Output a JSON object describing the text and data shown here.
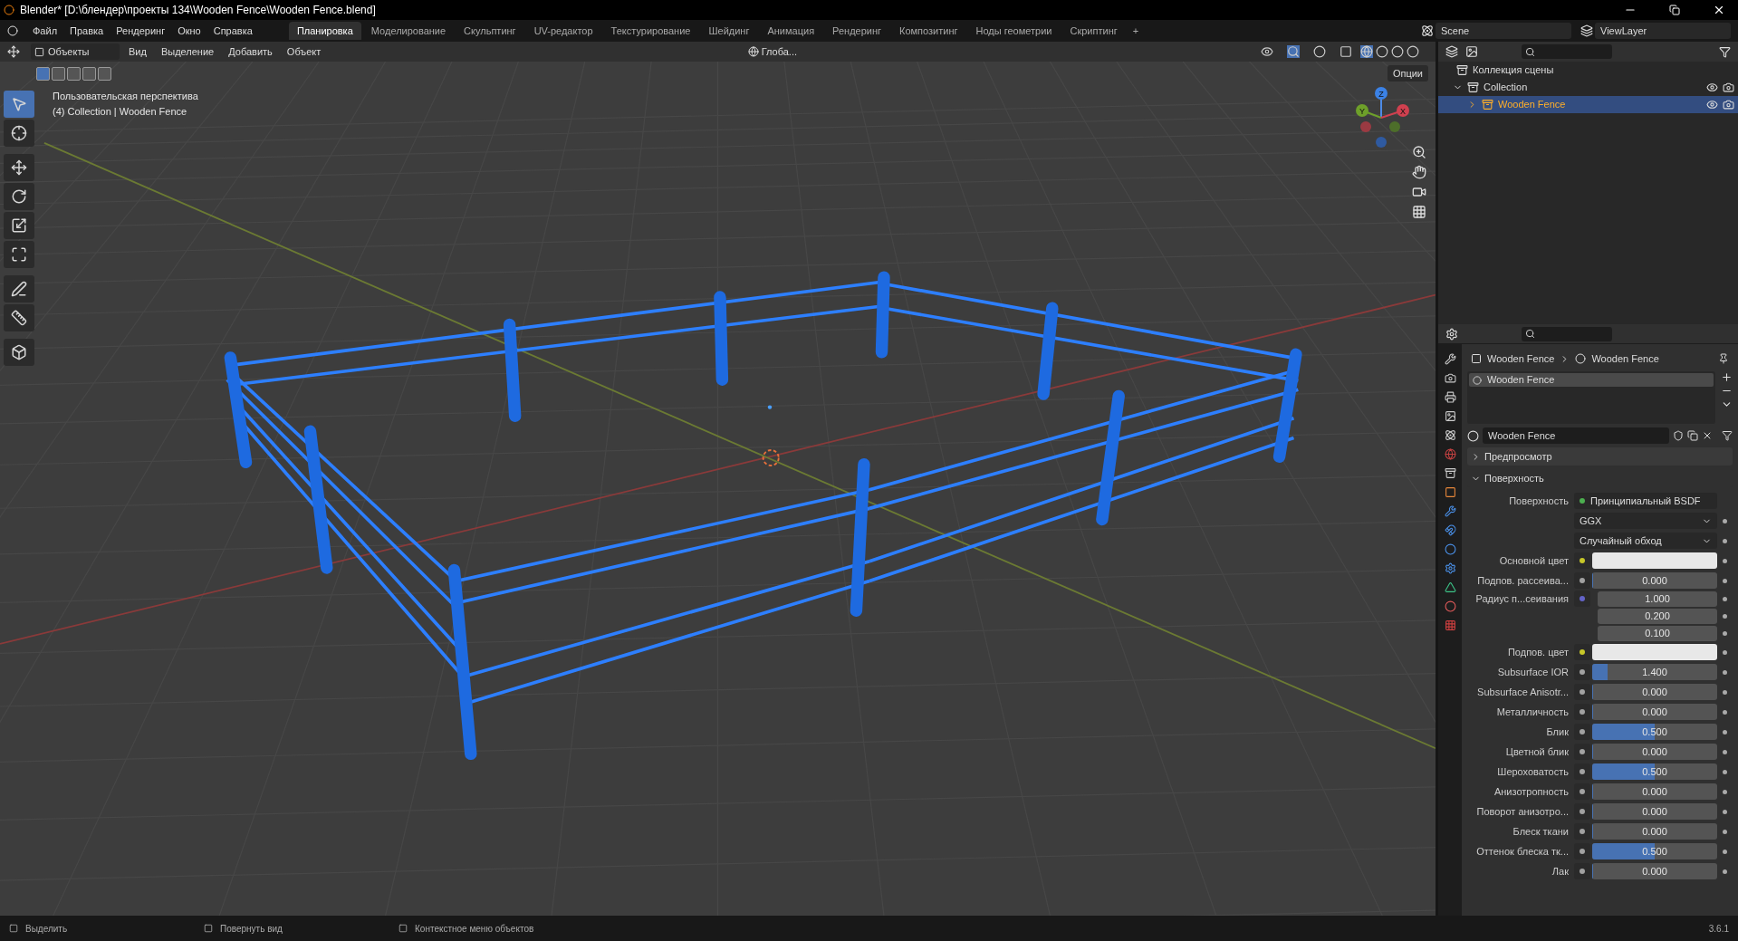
{
  "window": {
    "title": "Blender* [D:\\блендер\\проекты 134\\Wooden Fence\\Wooden Fence.blend]"
  },
  "menu": [
    "Файл",
    "Правка",
    "Рендеринг",
    "Окно",
    "Справка"
  ],
  "workspaces": [
    {
      "label": "Планировка",
      "selected": true
    },
    {
      "label": "Моделирование",
      "selected": false
    },
    {
      "label": "Скульптинг",
      "selected": false
    },
    {
      "label": "UV-редактор",
      "selected": false
    },
    {
      "label": "Текстурирование",
      "selected": false
    },
    {
      "label": "Шейдинг",
      "selected": false
    },
    {
      "label": "Анимация",
      "selected": false
    },
    {
      "label": "Рендеринг",
      "selected": false
    },
    {
      "label": "Композитинг",
      "selected": false
    },
    {
      "label": "Ноды геометрии",
      "selected": false
    },
    {
      "label": "Скриптинг",
      "selected": false
    }
  ],
  "add_workspace": "+",
  "scene": "Scene",
  "view_layer": "ViewLayer",
  "viewport_header": {
    "mode": "Объекты",
    "menus": [
      "Вид",
      "Выделение",
      "Добавить",
      "Объект"
    ],
    "orientation": "Глоба...",
    "options": "Опции"
  },
  "viewport": {
    "view_name": "Пользовательская перспектива",
    "context": "(4) Collection | Wooden Fence",
    "gizmo": {
      "z": "Z",
      "y": "Y",
      "x": "X"
    }
  },
  "tools": [
    {
      "kind": "select",
      "selected": true
    },
    {
      "kind": "cursor",
      "selected": false
    },
    {
      "kind": "move",
      "selected": false
    },
    {
      "kind": "rotate",
      "selected": false
    },
    {
      "kind": "scale",
      "selected": false
    },
    {
      "kind": "transform",
      "selected": false
    },
    {
      "kind": "annotate",
      "selected": false
    },
    {
      "kind": "measure",
      "selected": false
    },
    {
      "kind": "add",
      "selected": false
    }
  ],
  "outliner": {
    "root": "Коллекция сцены",
    "items": [
      {
        "label": "Collection",
        "expanded": true,
        "selected": false,
        "children": [
          {
            "label": "Wooden Fence",
            "expanded": false,
            "selected": true
          }
        ]
      }
    ]
  },
  "properties": {
    "breadcrumb": [
      "Wooden Fence",
      "Wooden Fence"
    ],
    "slot": "Wooden Fence",
    "material": "Wooden Fence",
    "panels": [
      {
        "label": "Предпросмотр",
        "expanded": false
      },
      {
        "label": "Поверхность",
        "expanded": true
      }
    ],
    "rows": [
      {
        "kind": "shader",
        "label": "Поверхность",
        "value": "Принципиальный BSDF",
        "color": "#4caf50"
      },
      {
        "kind": "dropdown",
        "value": "GGX"
      },
      {
        "kind": "dropdown",
        "value": "Случайный обход"
      },
      {
        "kind": "color",
        "label": "Основной цвет",
        "color": "#c7c729"
      },
      {
        "kind": "slider",
        "label": "Подпов. рассеива...",
        "value": "0.000",
        "level": 0,
        "color": "#a1a1a1"
      },
      {
        "kind": "vector",
        "label": "Радиус п...сеивания",
        "values": [
          "1.000",
          "0.200",
          "0.100"
        ],
        "color": "#6363c7"
      },
      {
        "kind": "color",
        "label": "Подпов. цвет",
        "color": "#c7c729"
      },
      {
        "kind": "slider",
        "label": "Subsurface IOR",
        "value": "1.400",
        "level": 0.12,
        "color": "#a1a1a1"
      },
      {
        "kind": "slider",
        "label": "Subsurface Anisotr...",
        "value": "0.000",
        "level": 0,
        "color": "#a1a1a1"
      },
      {
        "kind": "slider",
        "label": "Металличность",
        "value": "0.000",
        "level": 0,
        "color": "#a1a1a1"
      },
      {
        "kind": "slider",
        "label": "Блик",
        "value": "0.500",
        "level": 0.5,
        "color": "#a1a1a1"
      },
      {
        "kind": "slider",
        "label": "Цветной блик",
        "value": "0.000",
        "level": 0,
        "color": "#a1a1a1"
      },
      {
        "kind": "slider",
        "label": "Шероховатость",
        "value": "0.500",
        "level": 0.5,
        "color": "#a1a1a1"
      },
      {
        "kind": "slider",
        "label": "Анизотропность",
        "value": "0.000",
        "level": 0,
        "color": "#a1a1a1"
      },
      {
        "kind": "slider",
        "label": "Поворот анизотро...",
        "value": "0.000",
        "level": 0,
        "color": "#a1a1a1"
      },
      {
        "kind": "slider",
        "label": "Блеск ткани",
        "value": "0.000",
        "level": 0,
        "color": "#a1a1a1"
      },
      {
        "kind": "slider",
        "label": "Оттенок блеска тк...",
        "value": "0.500",
        "level": 0.5,
        "color": "#a1a1a1"
      },
      {
        "kind": "slider",
        "label": "Лак",
        "value": "0.000",
        "level": 0,
        "color": "#a1a1a1"
      }
    ]
  },
  "status_bar": {
    "hints": [
      "Выделить",
      "Повернуть вид",
      "Контекстное меню объектов"
    ],
    "version": "3.6.1"
  }
}
